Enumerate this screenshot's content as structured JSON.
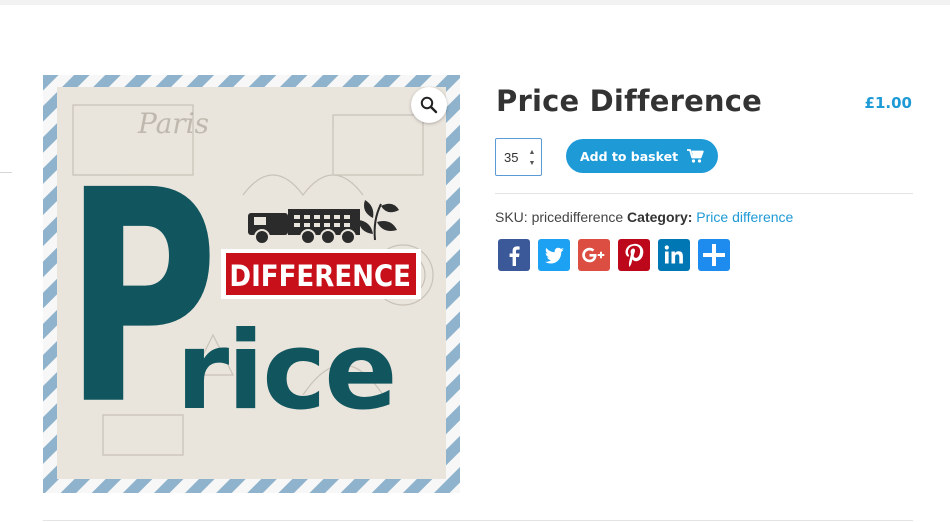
{
  "product": {
    "title": "Price Difference",
    "price": "£1.00",
    "quantity": "35",
    "add_to_basket_label": "Add to basket",
    "sku_label": "SKU:",
    "sku_value": "pricedifference",
    "category_label": "Category:",
    "category_value": "Price difference"
  },
  "product_image": {
    "banner_text": "DIFFERENCE",
    "big_letter": "P",
    "word_rest": "rice",
    "postmark_text": "Paris",
    "icons": [
      "truck-icon",
      "leaf-icon"
    ]
  },
  "share": {
    "icons": [
      "facebook-icon",
      "twitter-icon",
      "google-plus-icon",
      "pinterest-icon",
      "linkedin-icon",
      "share-icon"
    ]
  },
  "colors": {
    "accent": "#1e9ad6",
    "teal": "#11565f",
    "banner_red": "#c8101b",
    "facebook": "#3b5998",
    "twitter": "#1da1f2",
    "google_plus": "#dc4e41",
    "pinterest": "#bd081c",
    "linkedin": "#0077b5",
    "share": "#1e8cef"
  }
}
